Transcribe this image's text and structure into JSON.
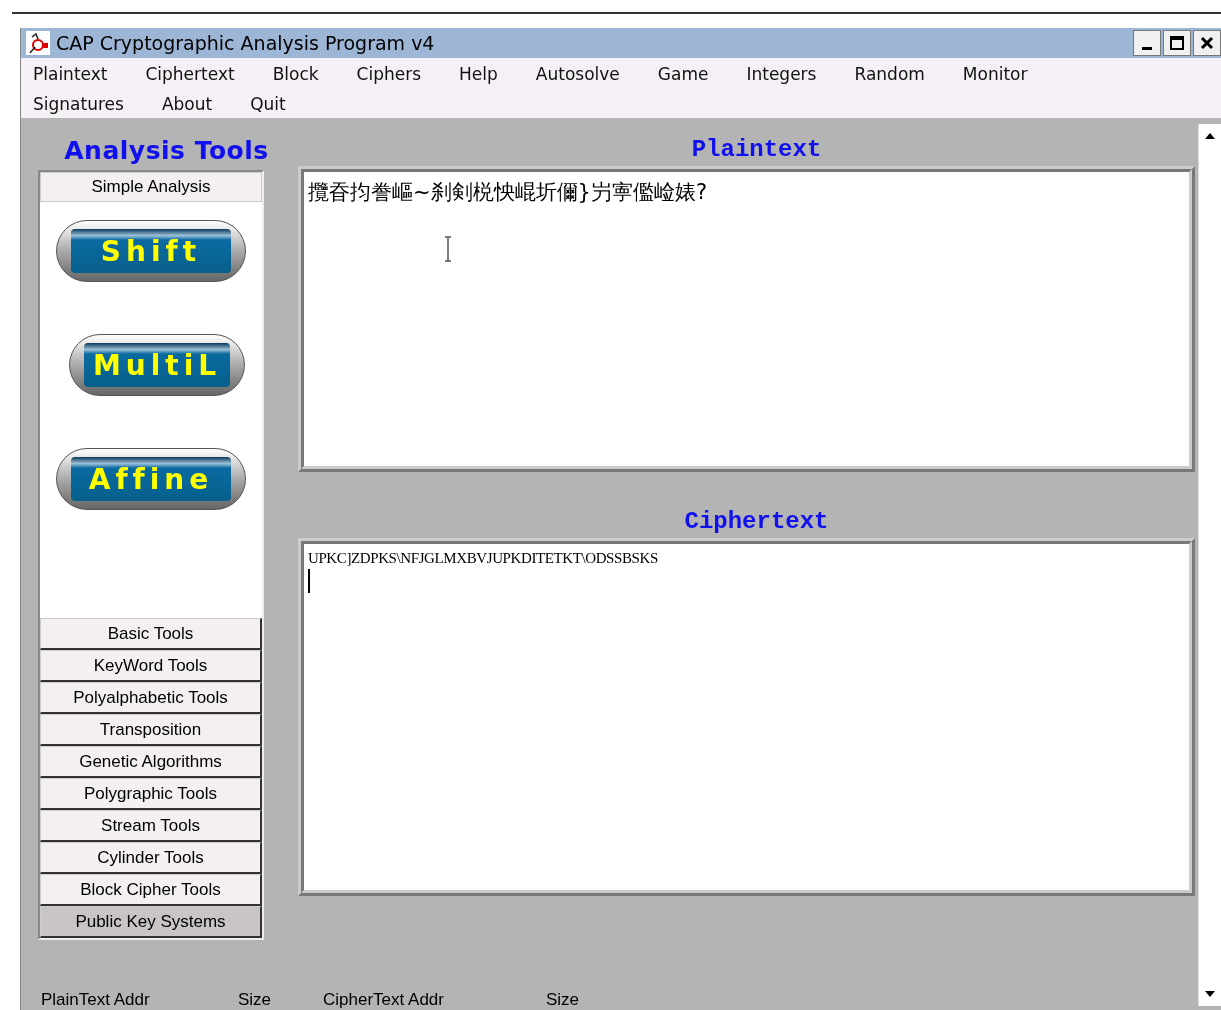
{
  "window": {
    "title": "CAP  Cryptographic Analysis Program v4"
  },
  "menu": [
    {
      "label": "Plaintext"
    },
    {
      "label": "Ciphertext"
    },
    {
      "label": "Block"
    },
    {
      "label": "Ciphers"
    },
    {
      "label": "Help"
    },
    {
      "label": "Autosolve"
    },
    {
      "label": "Game"
    },
    {
      "label": "Integers"
    },
    {
      "label": "Random"
    },
    {
      "label": "Monitor"
    },
    {
      "label": "Signatures"
    },
    {
      "label": "About"
    },
    {
      "label": "Quit"
    }
  ],
  "sidebar": {
    "title": "Analysis Tools",
    "open_group": "Simple Analysis",
    "tool_buttons": [
      "Shift",
      "MultiL",
      "Affine"
    ],
    "groups": [
      {
        "label": "Basic Tools",
        "highlighted": false
      },
      {
        "label": "KeyWord Tools",
        "highlighted": false
      },
      {
        "label": "Polyalphabetic Tools",
        "highlighted": false
      },
      {
        "label": "Transposition",
        "highlighted": false
      },
      {
        "label": "Genetic Algorithms",
        "highlighted": false
      },
      {
        "label": "Polygraphic Tools",
        "highlighted": false
      },
      {
        "label": "Stream Tools",
        "highlighted": false
      },
      {
        "label": "Cylinder Tools",
        "highlighted": false
      },
      {
        "label": "Block Cipher Tools",
        "highlighted": false
      },
      {
        "label": "Public Key Systems",
        "highlighted": true
      }
    ]
  },
  "plaintext": {
    "title": "Plaintext",
    "value": "攬昋抣誊嶇~刹剣棁怏崐圻儞}屶寕儖崄婊?"
  },
  "ciphertext": {
    "title": "Ciphertext",
    "value": "UPKC]ZDPKS\\NFJGLMXBVJUPKDITETKT\\ODSSBSKS"
  },
  "status_bar": [
    "PlainText Addr",
    "Size",
    "CipherText Addr",
    "Size"
  ]
}
